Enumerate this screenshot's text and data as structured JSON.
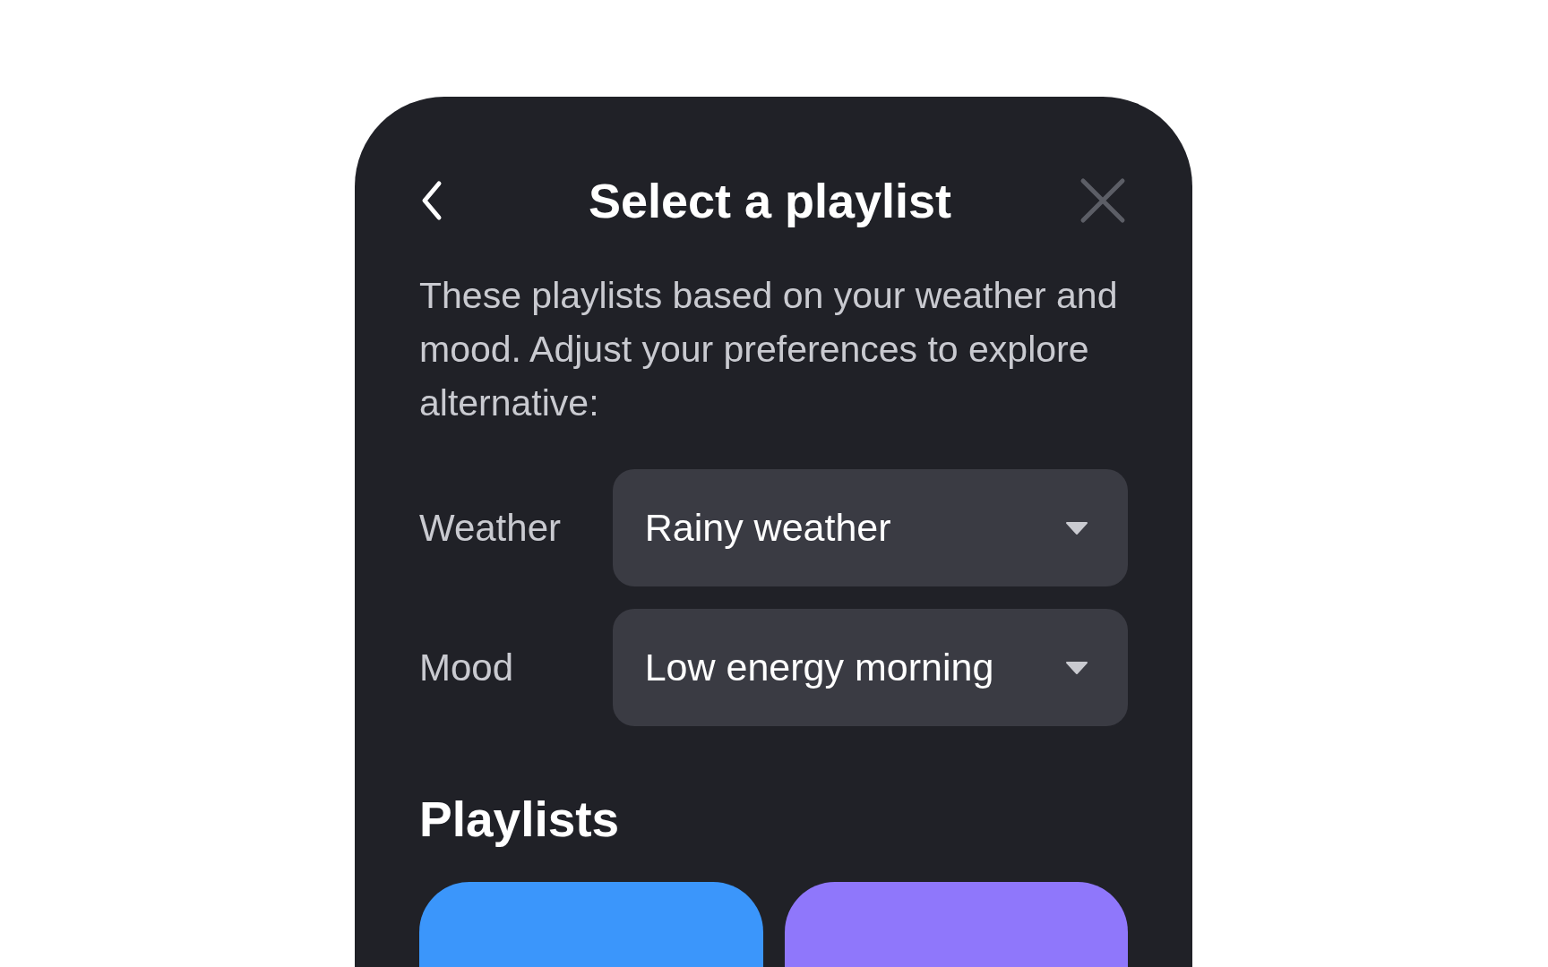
{
  "header": {
    "title": "Select a playlist"
  },
  "description": "These playlists based on your weather and mood. Adjust your preferences to explore alternative:",
  "filters": [
    {
      "label": "Weather",
      "value": "Rainy weather"
    },
    {
      "label": "Mood",
      "value": "Low energy morning"
    }
  ],
  "playlists": {
    "title": "Playlists",
    "cards": [
      {
        "color": "#3b96fb"
      },
      {
        "color": "#8f77fb"
      }
    ]
  }
}
